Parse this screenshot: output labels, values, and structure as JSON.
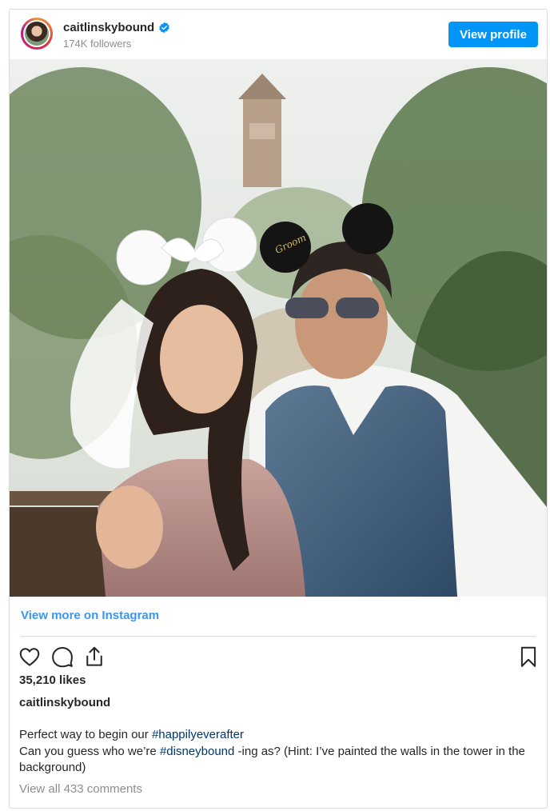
{
  "header": {
    "username": "caitlinskybound",
    "followers": "174K followers",
    "view_profile_label": "View profile"
  },
  "post": {
    "image_alt": "Couple posing with Minnie and Groom mouse ears in front of a tower",
    "ear_hat_text": "Groom"
  },
  "links": {
    "view_more": "View more on Instagram"
  },
  "actions": [
    "heart-icon",
    "comment-icon",
    "share-icon",
    "bookmark-icon"
  ],
  "stats": {
    "likes": "35,210 likes"
  },
  "caption": {
    "username": "caitlinskybound",
    "line1_pre": "Perfect way to begin our ",
    "line1_tag": "#happilyeverafter",
    "line2_pre": "Can you guess who we’re ",
    "line2_tag": "#disneybound",
    "line2_post": " -ing as? (Hint: I’ve painted the walls in the tower in the background)"
  },
  "comments": {
    "view_all": "View all 433 comments"
  },
  "colors": {
    "accent": "#0095f6",
    "link": "#3897f0",
    "hashtag": "#00376b",
    "muted": "#8e8e8e"
  }
}
